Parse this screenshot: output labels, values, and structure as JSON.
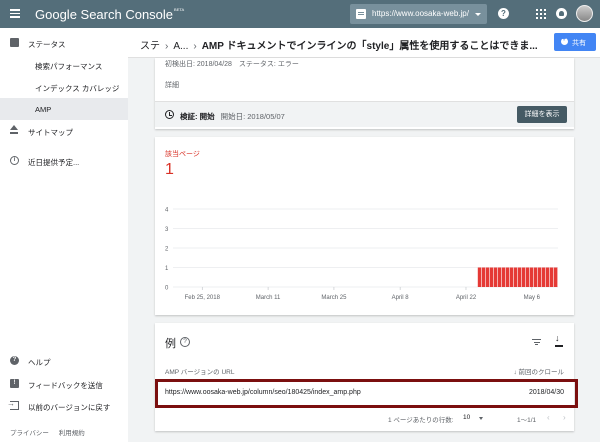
{
  "app": {
    "brand": "Google Search Console",
    "badge": "BETA"
  },
  "topbar": {
    "property_url": "https://www.oosaka-web.jp/"
  },
  "sidebar": {
    "items": [
      {
        "label": "ステータス"
      },
      {
        "label": "検索パフォーマンス"
      },
      {
        "label": "インデックス カバレッジ"
      },
      {
        "label": "AMP"
      },
      {
        "label": "サイトマップ"
      },
      {
        "label": "近日提供予定..."
      },
      {
        "label": "ヘルプ"
      },
      {
        "label": "フィードバックを送信"
      },
      {
        "label": "以前のバージョンに戻す"
      }
    ],
    "footer": {
      "privacy": "プライバシー",
      "terms": "利用規約"
    }
  },
  "header": {
    "breadcrumb": [
      "ステ",
      "A...",
      "AMP ドキュメントでインラインの「style」属性を使用することはできま..."
    ],
    "share_label": "共有"
  },
  "issue": {
    "meta": "初検出日: 2018/04/28　ステータス: エラー",
    "details_label": "詳細",
    "validation_label": "検証: 開始",
    "validation_date": "開始日: 2018/05/07",
    "details_button": "詳細を表示"
  },
  "affected": {
    "label": "該当ページ",
    "count": "1"
  },
  "colors": {
    "bar": "#e53935",
    "accent": "#4285f4",
    "topbar": "#546e7a",
    "error": "#d93025"
  },
  "chart_data": {
    "type": "bar",
    "x_tick_labels": [
      "Feb 25, 2018",
      "March 11",
      "March 25",
      "April 8",
      "April 22",
      "May 6"
    ],
    "y_ticks": [
      0,
      1,
      2,
      3,
      4
    ],
    "ylim": [
      0,
      4
    ],
    "series": [
      {
        "values": [
          0,
          0,
          0,
          0,
          0,
          0,
          0,
          0,
          0,
          0,
          0,
          0,
          0,
          0,
          0,
          0,
          0,
          0,
          0,
          0,
          0,
          0,
          0,
          0,
          0,
          0,
          0,
          0,
          0,
          0,
          0,
          0,
          0,
          0,
          0,
          0,
          0,
          0,
          0,
          0,
          0,
          0,
          0,
          0,
          0,
          0,
          0,
          0,
          0,
          0,
          0,
          0,
          0,
          0,
          0,
          0,
          0,
          0,
          0,
          0,
          0,
          0,
          0,
          0,
          0,
          0,
          0,
          0,
          0,
          0,
          0,
          0,
          0,
          0,
          0,
          0,
          1,
          1,
          1,
          1,
          1,
          1,
          1,
          1,
          1,
          1,
          1,
          1,
          1,
          1,
          1,
          1,
          1,
          1,
          1,
          1
        ]
      }
    ],
    "grid": true
  },
  "examples": {
    "title": "例",
    "col_url": "AMP バージョンの URL",
    "col_crawl": "前回のクロール",
    "rows": [
      {
        "url": "https://www.oosaka-web.jp/column/seo/180425/index_amp.php",
        "date": "2018/04/30"
      }
    ],
    "pager": {
      "rows_per_page_label": "1 ページあたりの行数:",
      "rows_per_page": "10",
      "range": "1～1/1"
    }
  }
}
